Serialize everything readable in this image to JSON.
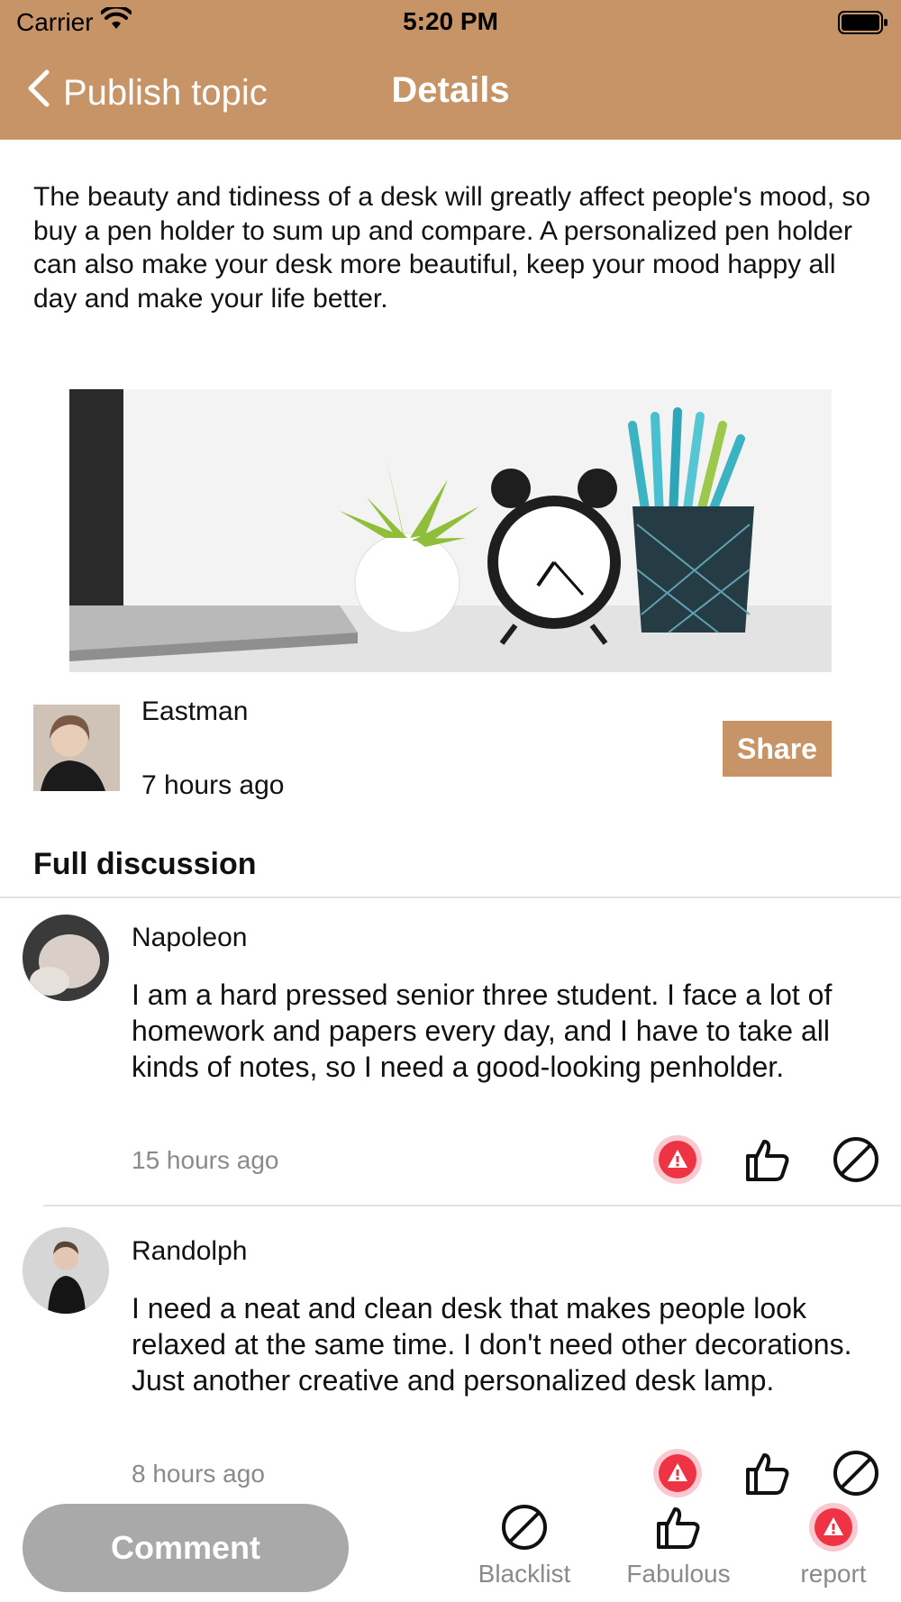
{
  "status_bar": {
    "carrier": "Carrier",
    "time": "5:20 PM"
  },
  "nav": {
    "back_label": "Publish topic",
    "title": "Details"
  },
  "post": {
    "body": "The beauty and tidiness of a desk will greatly affect people's mood, so buy a pen holder to sum up and compare. A personalized pen holder can also make your desk more beautiful, keep your mood happy all day and make your life better.",
    "author": "Eastman",
    "time": "7 hours ago",
    "share_label": "Share"
  },
  "discussion": {
    "title": "Full discussion",
    "comments": [
      {
        "name": "Napoleon",
        "text": "I am a hard pressed senior three student. I face a lot of homework and papers every day, and I have to take all kinds of notes, so I need a good-looking penholder.",
        "time": "15 hours ago"
      },
      {
        "name": "Randolph",
        "text": "I need a neat and clean desk that makes people look relaxed at the same time. I don't need other decorations. Just another creative and personalized desk lamp.",
        "time": "8 hours ago"
      }
    ]
  },
  "bottom_bar": {
    "comment_label": "Comment",
    "blacklist_label": "Blacklist",
    "fabulous_label": "Fabulous",
    "report_label": "report"
  },
  "colors": {
    "accent": "#c79468",
    "report_red": "#ee3344",
    "comment_button": "#a9a9a9",
    "muted_text": "#8a8a8a"
  },
  "icons": [
    "wifi-icon",
    "battery-icon",
    "chevron-left-icon",
    "report-icon",
    "thumbs-up-icon",
    "blacklist-icon"
  ]
}
